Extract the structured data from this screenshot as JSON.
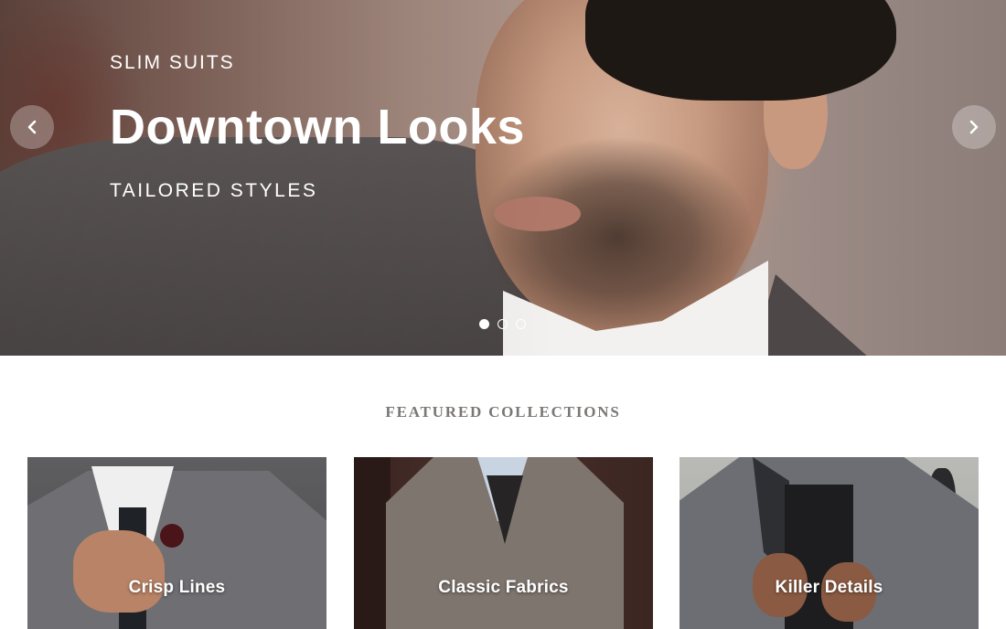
{
  "hero": {
    "eyebrow": "SLIM SUITS",
    "title": "Downtown Looks",
    "subtitle": "TAILORED STYLES",
    "prev_icon": "chevron-left-icon",
    "next_icon": "chevron-right-icon",
    "slides_count": 3,
    "active_slide": 1
  },
  "featured": {
    "heading": "FEATURED COLLECTIONS",
    "collections": [
      {
        "label": "Crisp Lines"
      },
      {
        "label": "Classic Fabrics"
      },
      {
        "label": "Killer Details"
      }
    ]
  }
}
